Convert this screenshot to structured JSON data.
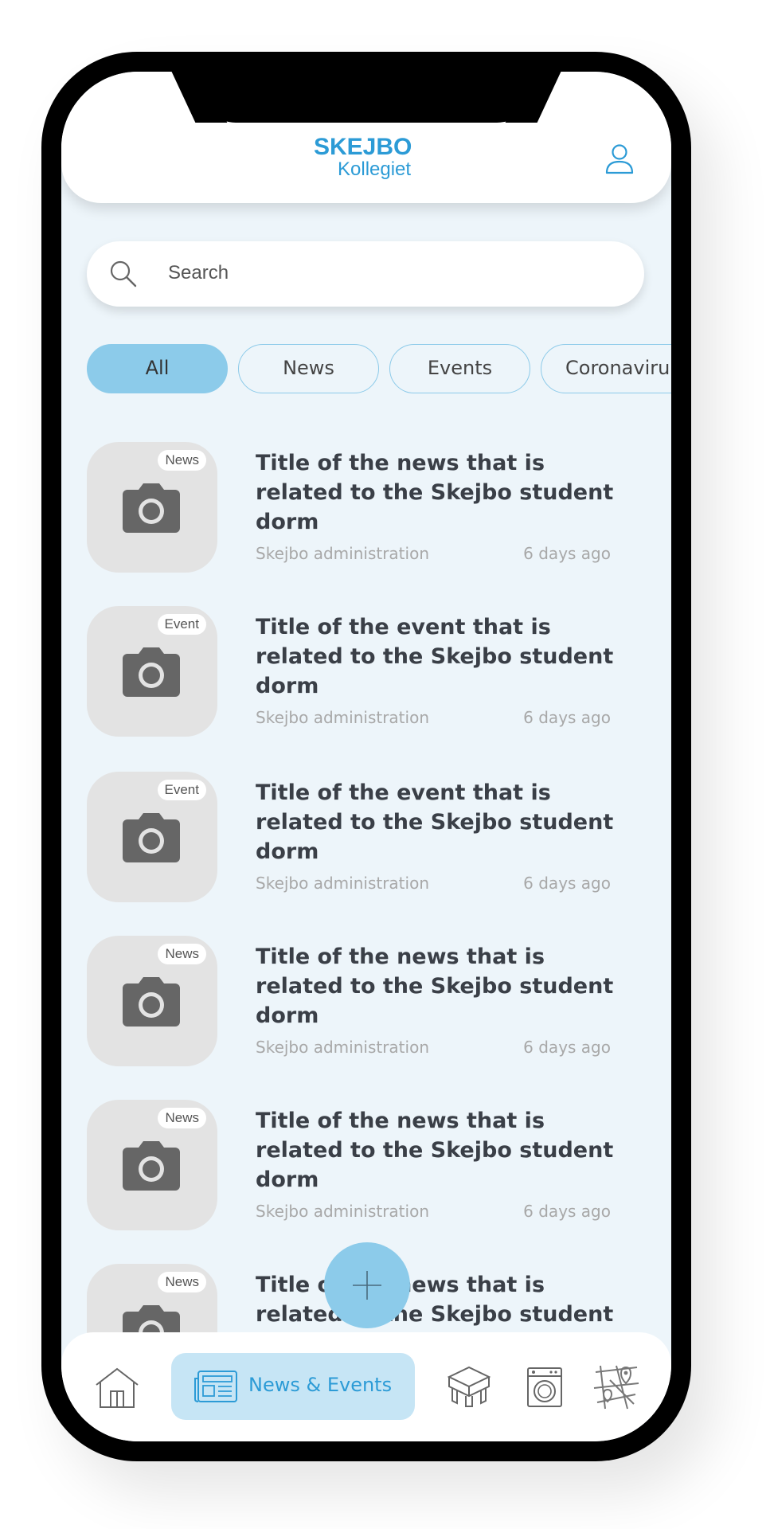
{
  "app": {
    "logo_line1": "SKEJBO",
    "logo_line2": "Kollegiet"
  },
  "search": {
    "placeholder": "Search"
  },
  "filters": [
    "All",
    "News",
    "Events",
    "Coronaviru"
  ],
  "feed": [
    {
      "tag": "News",
      "title": "Title of the news that is related to the Skejbo student dorm",
      "author": "Skejbo administration",
      "time": "6 days ago"
    },
    {
      "tag": "Event",
      "title": "Title of the event that is related to the Skejbo student dorm",
      "author": "Skejbo administration",
      "time": "6 days ago"
    },
    {
      "tag": "Event",
      "title": "Title of the event that is related to the Skejbo student dorm",
      "author": "Skejbo administration",
      "time": "6 days ago"
    },
    {
      "tag": "News",
      "title": "Title of the news that is related to the Skejbo student dorm",
      "author": "Skejbo administration",
      "time": "6 days ago"
    },
    {
      "tag": "News",
      "title": "Title of the news that is related to the Skejbo student dorm",
      "author": "Skejbo administration",
      "time": "6 days ago"
    },
    {
      "tag": "News",
      "title": "Title of the news that is related to the Skejbo student",
      "author": "",
      "time": ""
    }
  ],
  "fab": {
    "icon": "plus-icon"
  },
  "tabbar": {
    "home_icon": "house-icon",
    "active_label": "News & Events",
    "active_icon": "newspaper-icon",
    "furniture_icon": "furniture-icon",
    "laundry_icon": "washing-machine-icon",
    "map_icon": "map-icon"
  },
  "colors": {
    "brand": "#2c9bd6",
    "accent": "#8ccbea",
    "background": "#edf5fa"
  }
}
